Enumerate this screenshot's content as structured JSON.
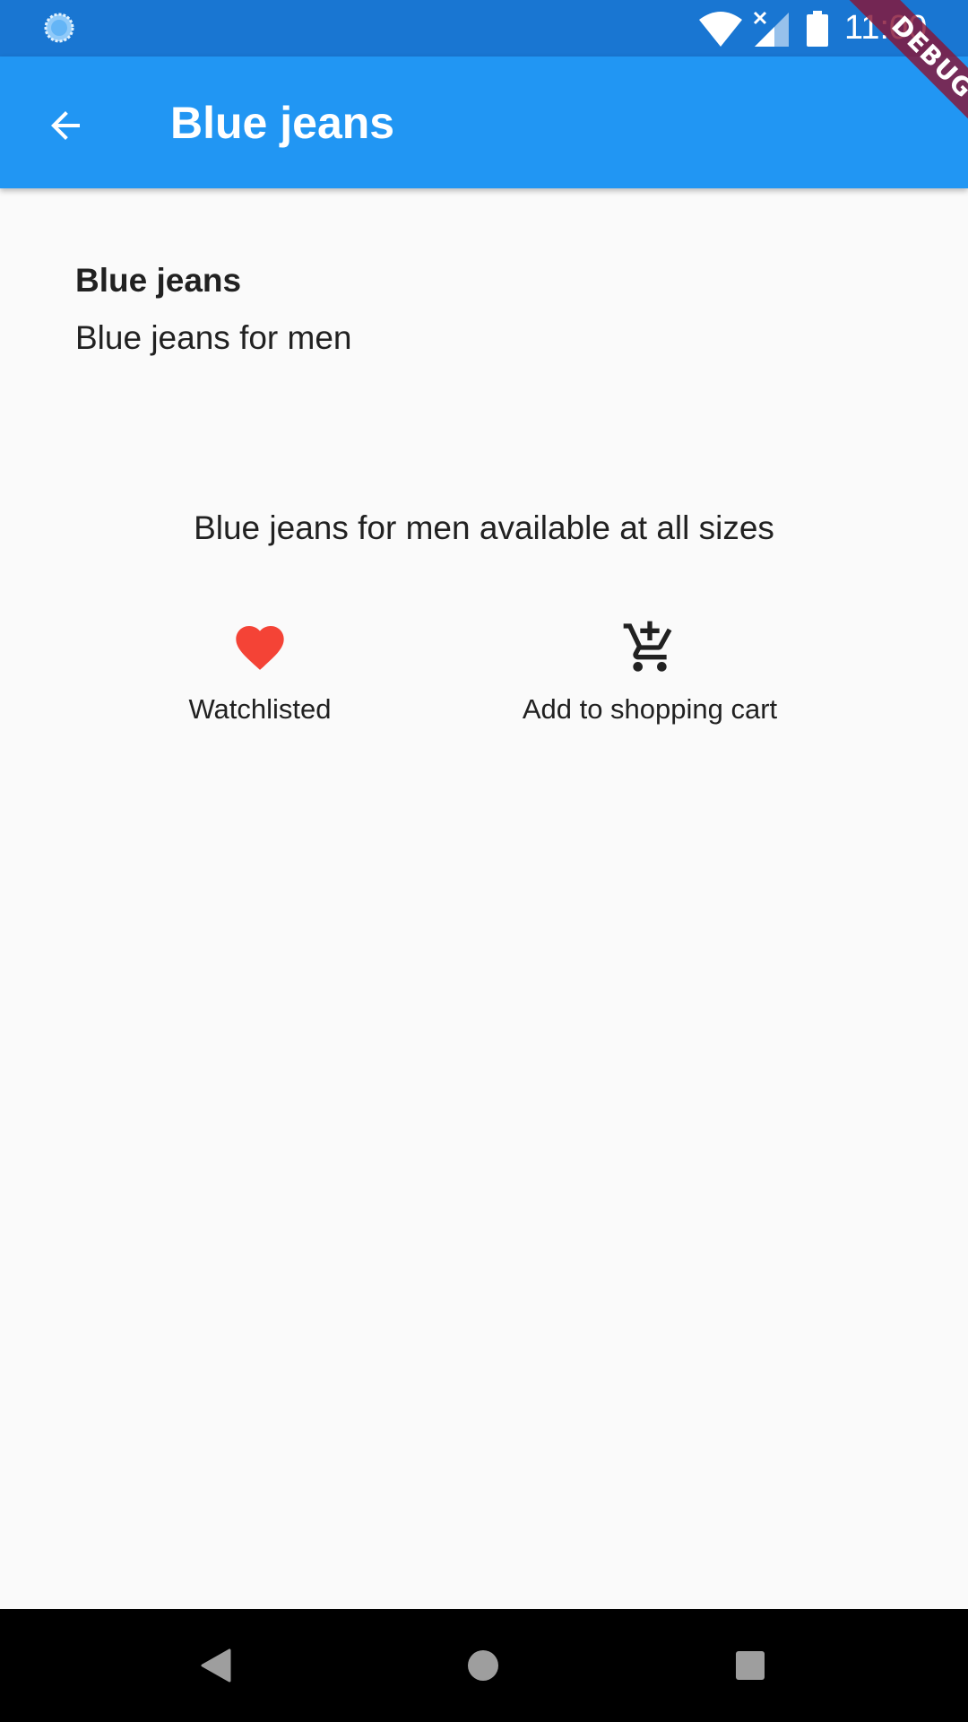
{
  "status_bar": {
    "time": "11:00",
    "icons": [
      "loading-icon",
      "wifi-icon",
      "signal-icon",
      "battery-icon"
    ]
  },
  "debug_banner": {
    "label": "DEBUG"
  },
  "app_bar": {
    "title": "Blue jeans",
    "back_icon": "arrow-back-icon"
  },
  "product": {
    "name": "Blue jeans",
    "subtitle": "Blue jeans for men",
    "description": "Blue jeans for men available at all sizes"
  },
  "actions": [
    {
      "label": "Watchlisted",
      "icon": "heart-icon",
      "color": "#f44336"
    },
    {
      "label": "Add to shopping cart",
      "icon": "add-shopping-cart-icon",
      "color": "#212121"
    }
  ],
  "colors": {
    "status_bar": "#1976d2",
    "app_bar": "#2196f3",
    "background": "#fafafa",
    "nav_bar": "#000000"
  }
}
